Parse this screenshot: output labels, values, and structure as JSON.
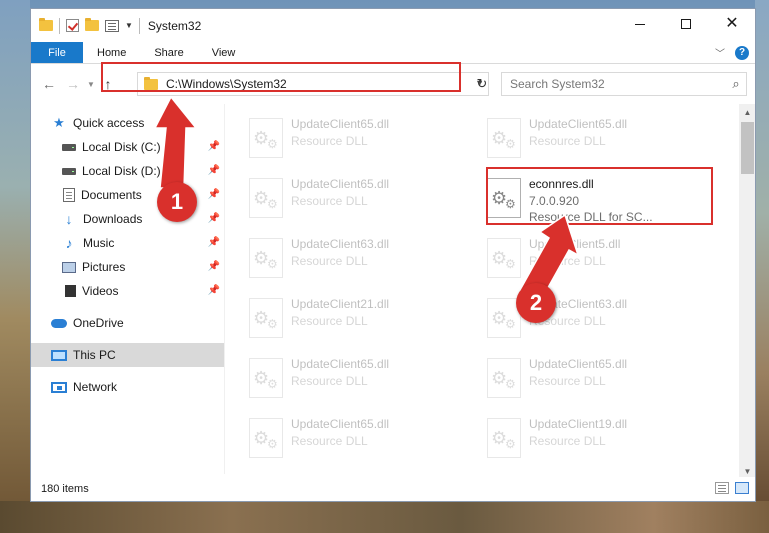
{
  "window": {
    "title": "System32",
    "controls": {
      "minimize": "",
      "maximize": "",
      "close": "✕"
    }
  },
  "ribbon": {
    "tabs": [
      "File",
      "Home",
      "Share",
      "View"
    ],
    "help": "?"
  },
  "address_bar": {
    "path": "C:\\Windows\\System32",
    "search_placeholder": "Search System32"
  },
  "sidebar": {
    "quick_access": "Quick access",
    "quick_items": [
      {
        "label": "Local Disk (C:)",
        "icon": "drive-icon"
      },
      {
        "label": "Local Disk (D:)",
        "icon": "drive-icon"
      },
      {
        "label": "Documents",
        "icon": "document-icon"
      },
      {
        "label": "Downloads",
        "icon": "download-icon"
      },
      {
        "label": "Music",
        "icon": "music-icon"
      },
      {
        "label": "Pictures",
        "icon": "pictures-icon"
      },
      {
        "label": "Videos",
        "icon": "videos-icon"
      }
    ],
    "onedrive": "OneDrive",
    "this_pc": "This PC",
    "network": "Network"
  },
  "files": [
    {
      "name": "UpdateClient65.dll",
      "desc": "Resource DLL"
    },
    {
      "name": "UpdateClient65.dll",
      "desc": "Resource DLL"
    },
    {
      "name": "UpdateClient65.dll",
      "desc": "Resource DLL"
    },
    {
      "name": "econnres.dll",
      "version": "7.0.0.920",
      "desc": "Resource DLL for SC..."
    },
    {
      "name": "UpdateClient63.dll",
      "desc": "Resource DLL"
    },
    {
      "name": "UpdateClient5.dll",
      "desc": "Resource DLL"
    },
    {
      "name": "UpdateClient21.dll",
      "desc": "Resource DLL"
    },
    {
      "name": "UpdateClient63.dll",
      "desc": "Resource DLL"
    },
    {
      "name": "UpdateClient65.dll",
      "desc": "Resource DLL"
    },
    {
      "name": "UpdateClient65.dll",
      "desc": "Resource DLL"
    },
    {
      "name": "UpdateClient65.dll",
      "desc": "Resource DLL"
    },
    {
      "name": "UpdateClient19.dll",
      "desc": "Resource DLL"
    }
  ],
  "status": {
    "item_count": "180 items"
  },
  "annotations": {
    "step1": "1",
    "step2": "2",
    "color": "#d9302c"
  }
}
